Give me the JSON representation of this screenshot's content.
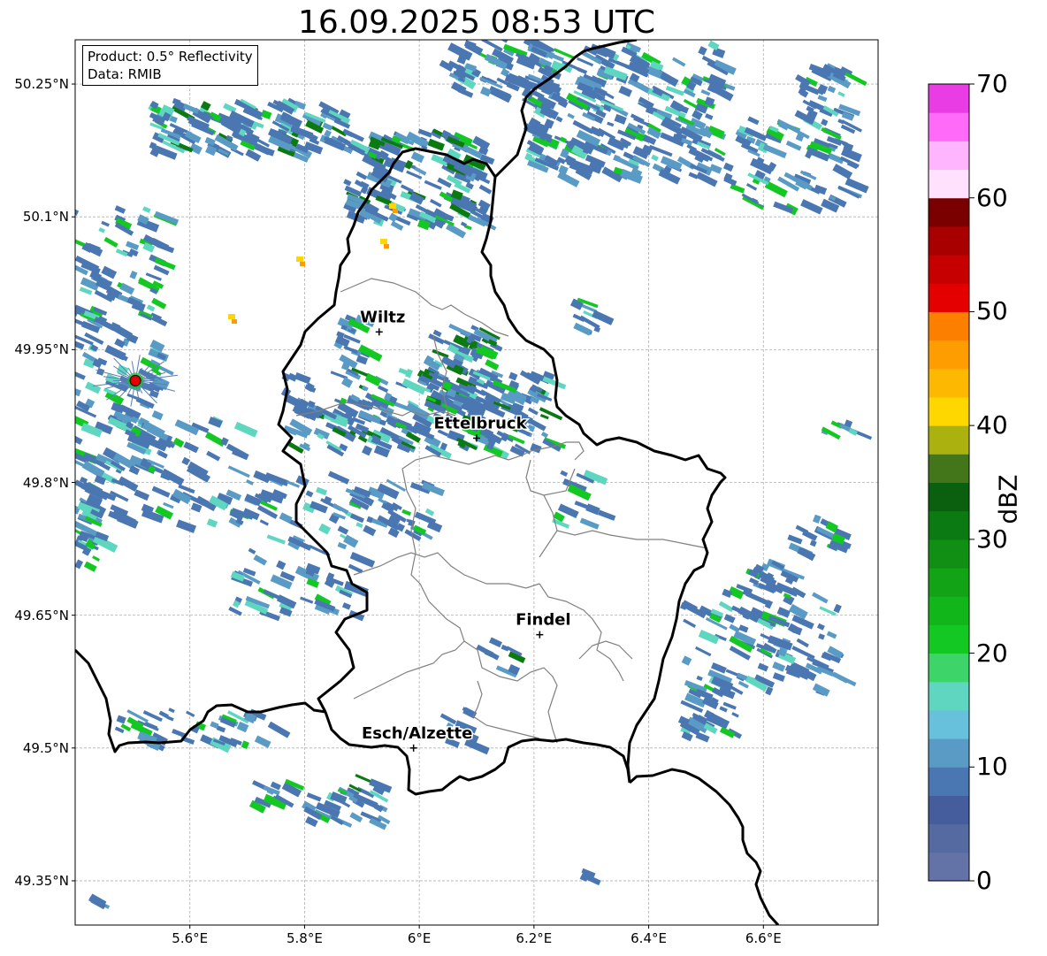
{
  "title": "16.09.2025 08:53 UTC",
  "info": {
    "product": "Product: 0.5° Reflectivity",
    "data": "Data: RMIB"
  },
  "lat_ticks": [
    {
      "value": 50.25,
      "label": "50.25°N"
    },
    {
      "value": 50.1,
      "label": "50.1°N"
    },
    {
      "value": 49.95,
      "label": "49.95°N"
    },
    {
      "value": 49.8,
      "label": "49.8°N"
    },
    {
      "value": 49.65,
      "label": "49.65°N"
    },
    {
      "value": 49.5,
      "label": "49.5°N"
    },
    {
      "value": 49.35,
      "label": "49.35°N"
    }
  ],
  "lon_ticks": [
    {
      "value": 5.6,
      "label": "5.6°E"
    },
    {
      "value": 5.8,
      "label": "5.8°E"
    },
    {
      "value": 6.0,
      "label": "6°E"
    },
    {
      "value": 6.2,
      "label": "6.2°E"
    },
    {
      "value": 6.4,
      "label": "6.4°E"
    },
    {
      "value": 6.6,
      "label": "6.6°E"
    }
  ],
  "extent": {
    "lon_min": 5.4,
    "lon_max": 6.8,
    "lat_min": 49.3,
    "lat_max": 50.3
  },
  "cities": [
    {
      "name": "Wiltz",
      "lon": 5.93,
      "lat": 49.97
    },
    {
      "name": "Ettelbruck",
      "lon": 6.1,
      "lat": 49.85
    },
    {
      "name": "Findel",
      "lon": 6.21,
      "lat": 49.628
    },
    {
      "name": "Esch/Alzette",
      "lon": 5.99,
      "lat": 49.5
    }
  ],
  "radar_site": {
    "lon": 5.505,
    "lat": 49.915
  },
  "colorbar": {
    "label": "dBZ",
    "min": 0,
    "max": 70,
    "ticks": [
      "0",
      "10",
      "20",
      "30",
      "40",
      "50",
      "60",
      "70"
    ],
    "colors": [
      "#6373a8",
      "#566aa2",
      "#455c9d",
      "#4a76b1",
      "#5a9bc6",
      "#67c1dc",
      "#5fd6c0",
      "#3dd46a",
      "#13c822",
      "#11b61a",
      "#12a317",
      "#108f14",
      "#0c7a12",
      "#0a600f",
      "#43751a",
      "#abb20f",
      "#fed701",
      "#fdb802",
      "#fd9d01",
      "#fd7f00",
      "#e50000",
      "#c60000",
      "#a80000",
      "#7a0000",
      "#ffe0fd",
      "#ffb4fd",
      "#ff6af8",
      "#ea3ce5"
    ]
  },
  "rain_colors": {
    "weak": "#4a76b1",
    "light": "#5a9bc6",
    "cyan": "#5fd6c0",
    "green": "#13c822",
    "dark_green": "#0c7a12",
    "yellow": "#fed701",
    "orange": "#fd9d01"
  }
}
